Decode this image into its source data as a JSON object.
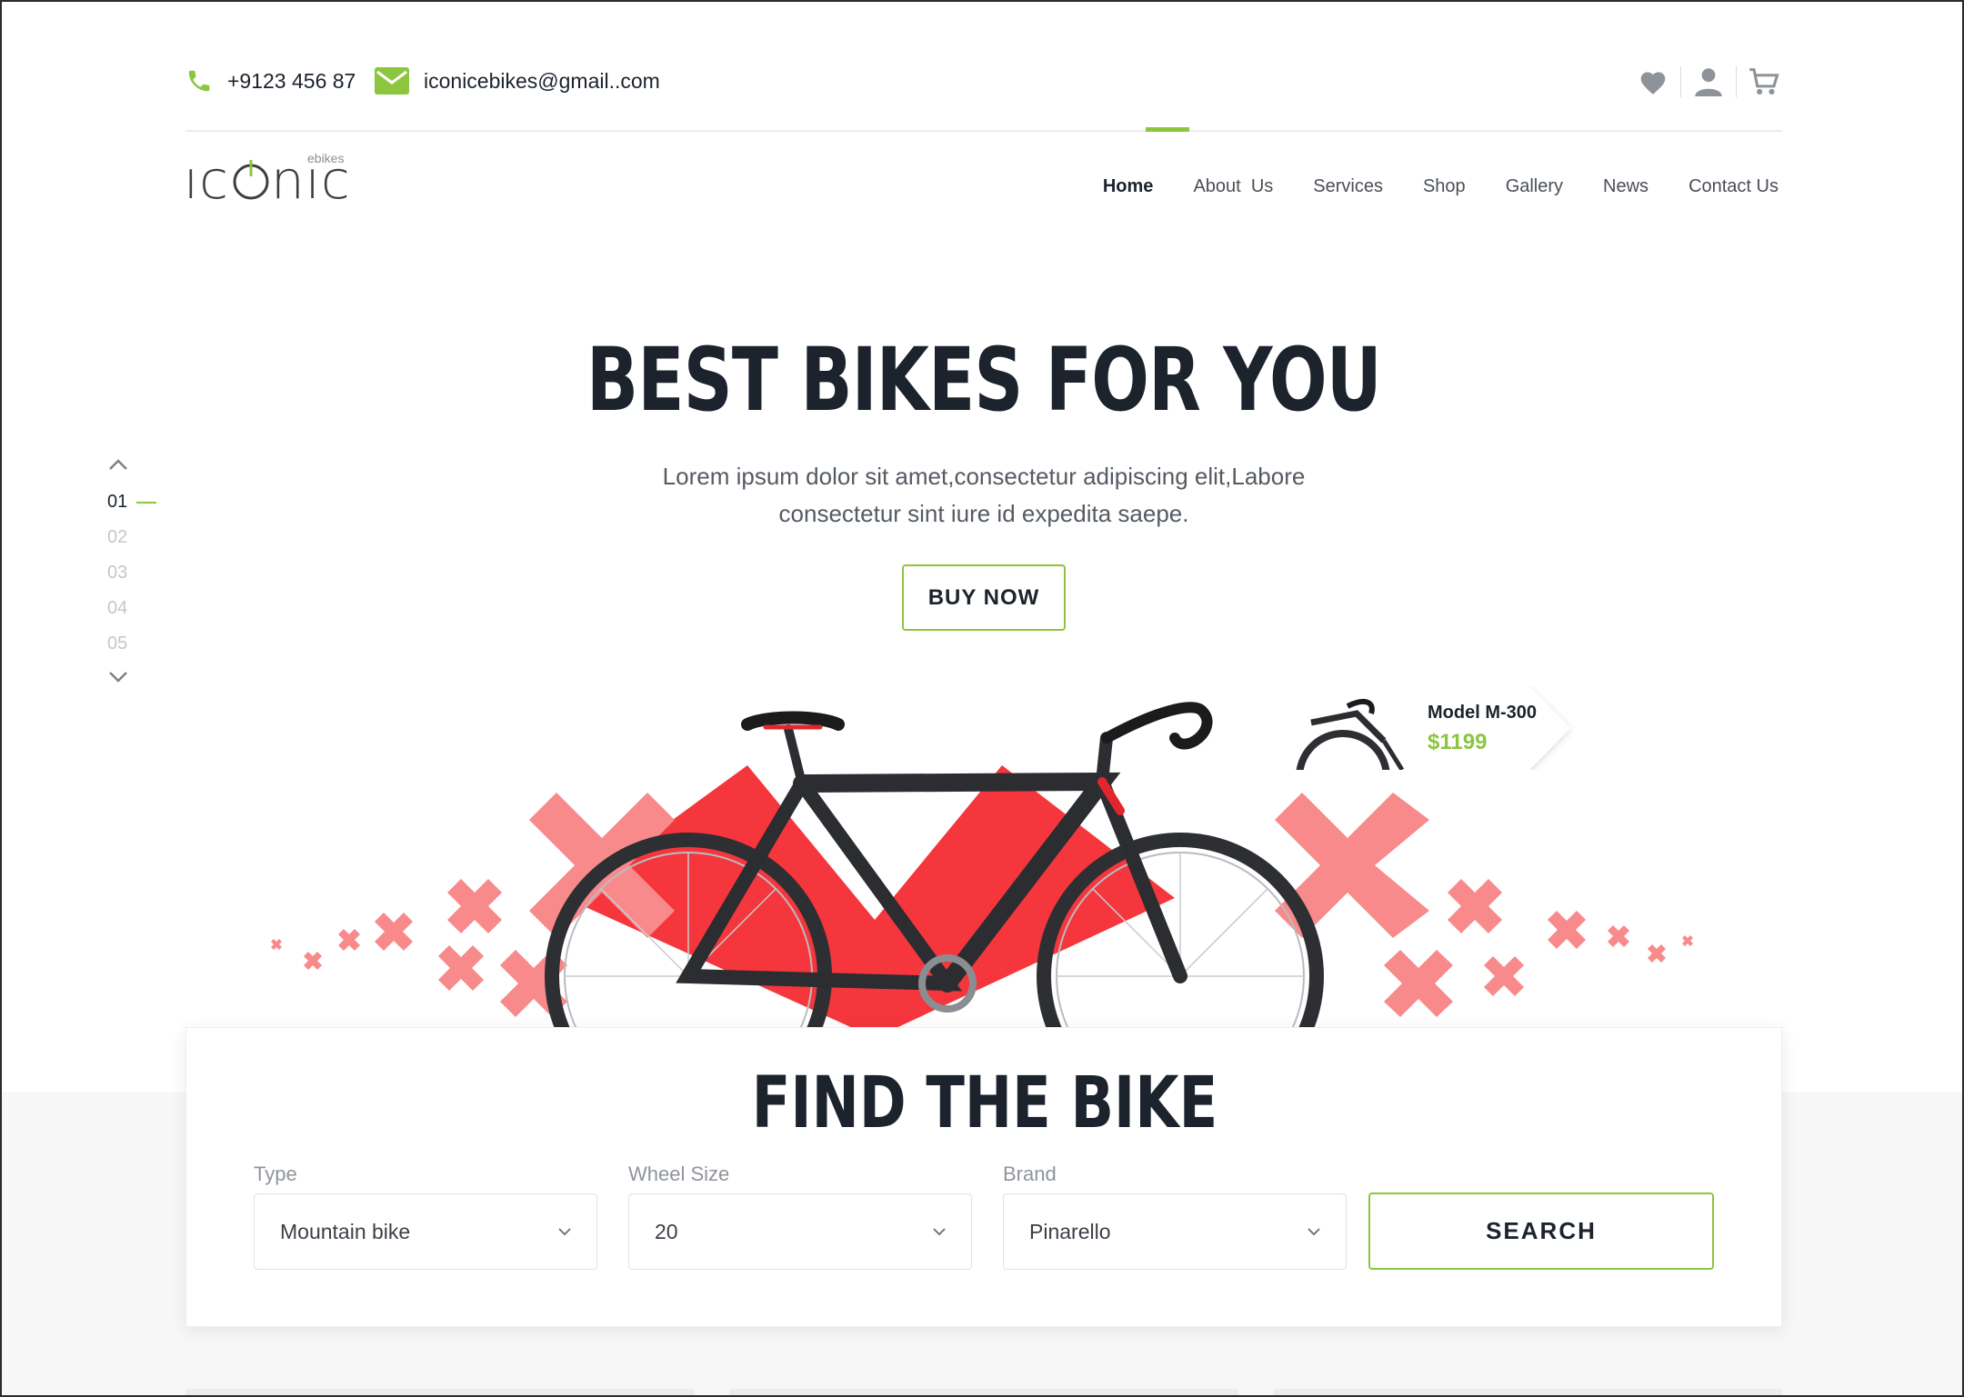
{
  "topbar": {
    "phone": "+9123 456 87",
    "email": "iconicebikes@gmail..com"
  },
  "logo": {
    "word": "ICONIC",
    "sub": "ebikes"
  },
  "nav": {
    "items": [
      "Home",
      "About  Us",
      "Services",
      "Shop",
      "Gallery",
      "News",
      "Contact Us"
    ],
    "active": "Home"
  },
  "hero": {
    "title": "BEST BIKES FOR YOU",
    "subtitle": "Lorem ipsum dolor sit amet,consectetur adipiscing elit,Labore consectetur sint iure id expedita saepe.",
    "cta": "BUY NOW"
  },
  "slider": {
    "items": [
      "01",
      "02",
      "03",
      "04",
      "05"
    ],
    "active": "01"
  },
  "product_tag": {
    "model": "Model M-300",
    "price": "$1199"
  },
  "finder": {
    "title": "FIND THE BIKE",
    "type": {
      "label": "Type",
      "value": "Mountain bike"
    },
    "wheel": {
      "label": "Wheel Size",
      "value": "20"
    },
    "brand": {
      "label": "Brand",
      "value": "Pinarello"
    },
    "search": "SEARCH"
  },
  "colors": {
    "accent": "#8cc63f",
    "dark": "#1c232d",
    "red": "#f5363c",
    "pink": "#f88a8c"
  },
  "icons": [
    "phone-icon",
    "mail-icon",
    "heart-icon",
    "user-icon",
    "cart-icon",
    "chevron-up-icon",
    "chevron-down-icon"
  ]
}
